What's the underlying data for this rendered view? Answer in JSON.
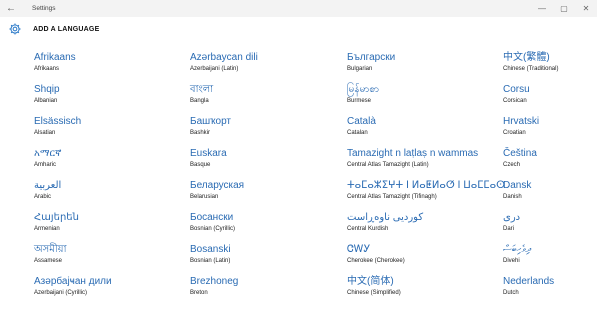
{
  "window": {
    "title": "Settings",
    "back_glyph": "←",
    "minimize_glyph": "—",
    "maximize_glyph": "▢",
    "close_glyph": "✕"
  },
  "header": {
    "icon": "gear-icon",
    "title": "ADD A LANGUAGE"
  },
  "colors": {
    "accent": "#2a6bb3",
    "titlebar": "#f3f3f3"
  },
  "languages": [
    {
      "native": "Afrikaans",
      "english": "Afrikaans"
    },
    {
      "native": "Shqip",
      "english": "Albanian"
    },
    {
      "native": "Elsässisch",
      "english": "Alsatian"
    },
    {
      "native": "አማርኛ",
      "english": "Amharic"
    },
    {
      "native": "العربية",
      "english": "Arabic"
    },
    {
      "native": "Հայերեն",
      "english": "Armenian"
    },
    {
      "native": "অসমীয়া",
      "english": "Assamese"
    },
    {
      "native": "Азәрбајҹан дили",
      "english": "Azerbaijani (Cyrillic)"
    },
    {
      "native": "Azərbaycan dili",
      "english": "Azerbaijani (Latin)"
    },
    {
      "native": "বাংলা",
      "english": "Bangla"
    },
    {
      "native": "Башҡорт",
      "english": "Bashkir"
    },
    {
      "native": "Euskara",
      "english": "Basque"
    },
    {
      "native": "Беларуская",
      "english": "Belarusian"
    },
    {
      "native": "Босански",
      "english": "Bosnian (Cyrillic)"
    },
    {
      "native": "Bosanski",
      "english": "Bosnian (Latin)"
    },
    {
      "native": "Brezhoneg",
      "english": "Breton"
    },
    {
      "native": "Български",
      "english": "Bulgarian"
    },
    {
      "native": "မြန်မာစာ",
      "english": "Burmese"
    },
    {
      "native": "Català",
      "english": "Catalan"
    },
    {
      "native": "Tamazight n laṭlaṣ n wammas",
      "english": "Central Atlas Tamazight (Latin)"
    },
    {
      "native": "ⵜⴰⵎⴰⵣⵉⵖⵜ ⵏ ⵍⴰⵟⵍⴰⵚ ⵏ ⵡⴰⵎⵎⴰⵙ",
      "english": "Central Atlas Tamazight (Tifinagh)"
    },
    {
      "native": "کوردیی ناوەڕاست",
      "english": "Central Kurdish"
    },
    {
      "native": "ᏣᎳᎩ",
      "english": "Cherokee (Cherokee)"
    },
    {
      "native": "中文(简体)",
      "english": "Chinese (Simplified)"
    },
    {
      "native": "中文(繁體)",
      "english": "Chinese (Traditional)"
    },
    {
      "native": "Corsu",
      "english": "Corsican"
    },
    {
      "native": "Hrvatski",
      "english": "Croatian"
    },
    {
      "native": "Čeština",
      "english": "Czech"
    },
    {
      "native": "Dansk",
      "english": "Danish"
    },
    {
      "native": "دری",
      "english": "Dari"
    },
    {
      "native": "ދިވެހިބަސް",
      "english": "Divehi"
    },
    {
      "native": "Nederlands",
      "english": "Dutch"
    }
  ]
}
